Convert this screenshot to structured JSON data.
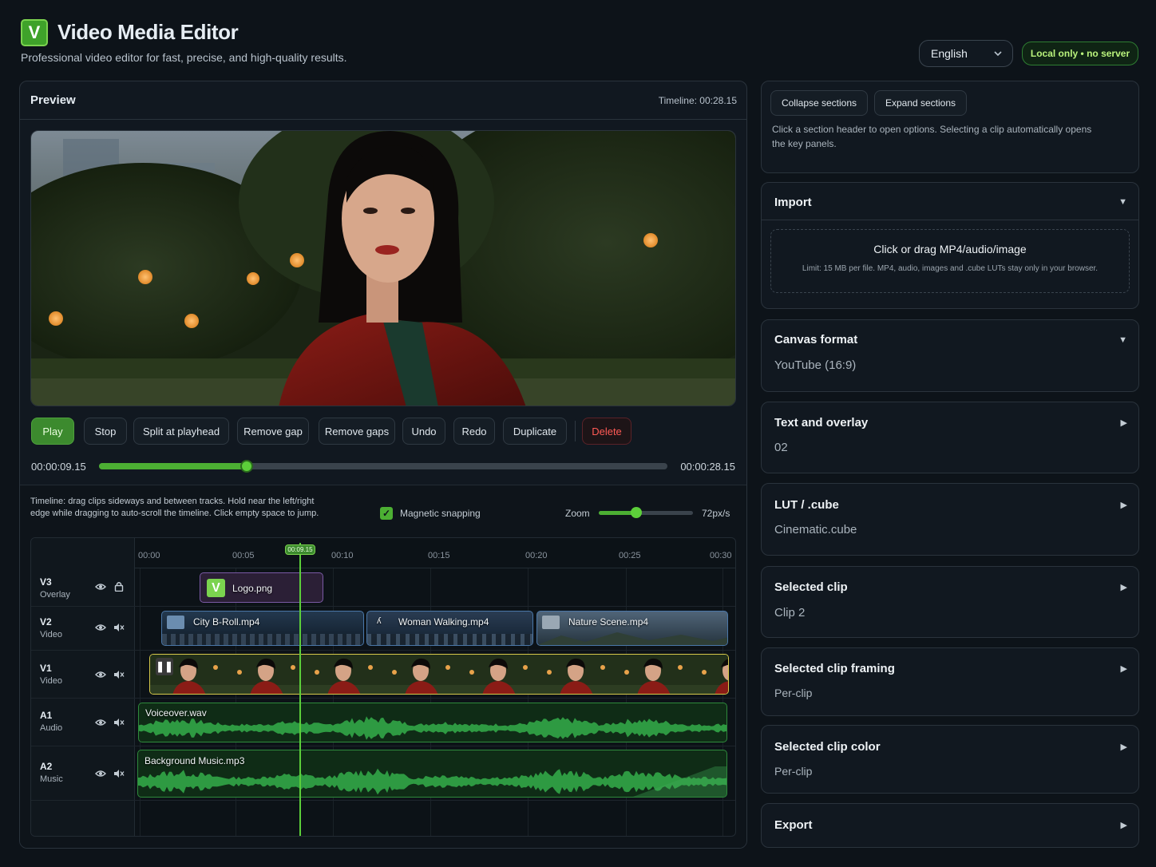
{
  "app": {
    "logo_letter": "V",
    "title": "Video Media Editor",
    "subtitle": "Professional video editor for fast, precise, and high-quality results.",
    "language": "English",
    "local_badge": "Local only • no server",
    "accent_color": "#4caf33"
  },
  "preview": {
    "title": "Preview",
    "timeline_readout": "Timeline: 00:28.15"
  },
  "toolbar": {
    "play": "Play",
    "stop": "Stop",
    "split": "Split at playhead",
    "remove_gap": "Remove gap",
    "remove_gaps": "Remove gaps",
    "undo": "Undo",
    "redo": "Redo",
    "duplicate": "Duplicate",
    "delete": "Delete"
  },
  "scrubber": {
    "current": "00:00:09.15",
    "total": "00:00:28.15",
    "progress": 0.26
  },
  "timeline": {
    "help": "Timeline: drag clips sideways and between tracks. Hold near the left/right edge while dragging to auto-scroll the timeline. Click empty space to jump.",
    "snapping_label": "Magnetic snapping",
    "snapping_checked": true,
    "check_mark": "✓",
    "zoom_label": "Zoom",
    "zoom_value": "72px/s",
    "zoom_level": 0.4,
    "playhead_tag": "00:09.15",
    "ruler": [
      "00:00",
      "00:05",
      "00:10",
      "00:15",
      "00:20",
      "00:25",
      "00:30"
    ],
    "tracks": [
      {
        "name": "V3",
        "type": "Overlay",
        "icons": [
          "eye-icon",
          "lock-icon"
        ]
      },
      {
        "name": "V2",
        "type": "Video",
        "icons": [
          "eye-icon",
          "mute-icon"
        ]
      },
      {
        "name": "V1",
        "type": "Video",
        "icons": [
          "eye-icon",
          "mute-icon"
        ]
      },
      {
        "name": "A1",
        "type": "Audio",
        "icons": [
          "eye-icon",
          "mute-icon"
        ]
      },
      {
        "name": "A2",
        "type": "Music",
        "icons": [
          "eye-icon",
          "mute-icon"
        ]
      }
    ],
    "clips": {
      "logo": "Logo.png",
      "city": "City B-Roll.mp4",
      "woman": "Woman Walking.mp4",
      "nature": "Nature Scene.mp4",
      "voiceover": "Voiceover.wav",
      "music": "Background Music.mp3"
    }
  },
  "sidebar": {
    "collapse": "Collapse sections",
    "expand": "Expand sections",
    "hint": "Click a section header to open options. Selecting a clip automatically opens the key panels.",
    "import": {
      "title": "Import",
      "drop_title": "Click or drag MP4/audio/image",
      "drop_limit": "Limit: 15 MB per file. MP4, audio, images and .cube LUTs stay only in your browser."
    },
    "sections": [
      {
        "title": "Canvas format",
        "value": "YouTube (16:9)",
        "open": true
      },
      {
        "title": "Text and overlay",
        "value": "02",
        "open": false
      },
      {
        "title": "LUT / .cube",
        "value": "Cinematic.cube",
        "open": false
      },
      {
        "title": "Selected clip",
        "value": "Clip 2",
        "open": false
      },
      {
        "title": "Selected clip framing",
        "value": "Per-clip",
        "open": false
      },
      {
        "title": "Selected clip color",
        "value": "Per-clip",
        "open": false
      },
      {
        "title": "Export",
        "value": "",
        "open": false
      }
    ],
    "arrow_open": "▼",
    "arrow_closed": "▶"
  }
}
